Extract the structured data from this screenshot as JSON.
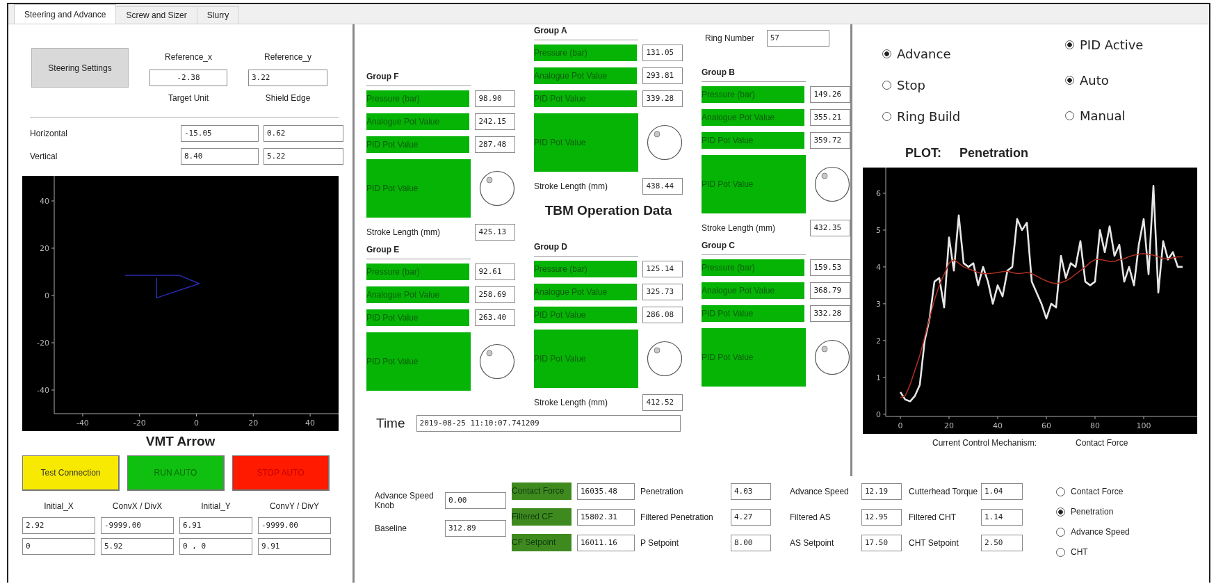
{
  "tabs": [
    {
      "label": "Steering and Advance",
      "selected": true
    },
    {
      "label": "Screw and Sizer",
      "selected": false
    },
    {
      "label": "Slurry",
      "selected": false
    }
  ],
  "steering": {
    "settings_button": "Steering Settings",
    "reference_x": {
      "label": "Reference_x",
      "value": "-2.38"
    },
    "reference_y": {
      "label": "Reference_y",
      "value": "3.22"
    },
    "captions": [
      "Target Unit",
      "Shield Edge"
    ],
    "offsets": [
      {
        "label": "Horizontal",
        "values": [
          "-15.05",
          "0.62"
        ]
      },
      {
        "label": "Vertical",
        "values": [
          "8.40",
          "5.22"
        ]
      }
    ]
  },
  "vmt_plot": {
    "title": "VMT Arrow",
    "chart_data": {
      "type": "line",
      "xlim": [
        -50,
        50
      ],
      "ylim": [
        -50,
        50
      ],
      "xticks": [
        -40,
        -20,
        0,
        20,
        40
      ],
      "yticks": [
        -40,
        -20,
        0,
        20,
        40
      ],
      "x": [
        -25,
        -6,
        1,
        -14,
        -14
      ],
      "series": [
        {
          "color": "#2a2ab0",
          "values": [
            8.5,
            8.5,
            5,
            -1,
            7.5
          ]
        }
      ]
    }
  },
  "action_buttons": [
    {
      "label": "Test Connection",
      "kind": "test"
    },
    {
      "label": "RUN AUTO",
      "kind": "run"
    },
    {
      "label": "STOP AUTO",
      "kind": "stop"
    }
  ],
  "calibration": {
    "columns": [
      "Initial_X",
      "ConvX / DivX",
      "Initial_Y",
      "ConvY / DivY"
    ],
    "rows": [
      [
        "2.92",
        "-9999.00",
        "6.91",
        "-9999.00"
      ],
      [
        "0",
        "5.92",
        "0 , 0",
        "9.91"
      ]
    ]
  },
  "operation": {
    "title": "TBM Operation Data",
    "ring_number": {
      "label": "Ring Number",
      "value": "57"
    },
    "columns": [
      {
        "groups": [
          {
            "name": "Group F",
            "readings": [
              {
                "label": "Pressure (bar)",
                "value": "98.90"
              },
              {
                "label": "Analogue Pot Value",
                "value": "242.15"
              },
              {
                "label": "PID Pot Value",
                "value": "287.48"
              }
            ],
            "pid_box": "PID Pot Value",
            "stroke": {
              "label": "Stroke Length (mm)",
              "value": "425.13"
            }
          },
          {
            "name": "Group E",
            "readings": [
              {
                "label": "Pressure (bar)",
                "value": "92.61"
              },
              {
                "label": "Analogue Pot Value",
                "value": "258.69"
              },
              {
                "label": "PID Pot Value",
                "value": "263.40"
              }
            ],
            "pid_box": "PID Pot Value"
          }
        ]
      },
      {
        "groups": [
          {
            "name": "Group A",
            "readings": [
              {
                "label": "Pressure (bar)",
                "value": "131.05"
              },
              {
                "label": "Analogue Pot Value",
                "value": "293.81"
              },
              {
                "label": "PID Pot Value",
                "value": "339.28"
              }
            ],
            "pid_box": "PID Pot Value",
            "stroke": {
              "label": "Stroke Length (mm)",
              "value": "438.44"
            }
          },
          {
            "name": "Group D",
            "readings": [
              {
                "label": "Pressure (bar)",
                "value": "125.14"
              },
              {
                "label": "Analogue Pot Value",
                "value": "325.73"
              },
              {
                "label": "PID Pot Value",
                "value": "286.08"
              }
            ],
            "pid_box": "PID Pot Value",
            "stroke": {
              "label": "Stroke Length (mm)",
              "value": "412.52"
            }
          }
        ]
      },
      {
        "groups": [
          {
            "name": "Group B",
            "readings": [
              {
                "label": "Pressure (bar)",
                "value": "149.26"
              },
              {
                "label": "Analogue Pot Value",
                "value": "355.21"
              },
              {
                "label": "PID Pot Value",
                "value": "359.72"
              }
            ],
            "pid_box": "PID Pot Value",
            "stroke": {
              "label": "Stroke Length (mm)",
              "value": "432.35"
            }
          },
          {
            "name": "Group C",
            "readings": [
              {
                "label": "Pressure (bar)",
                "value": "159.53"
              },
              {
                "label": "Analogue Pot Value",
                "value": "368.79"
              },
              {
                "label": "PID Pot Value",
                "value": "332.28"
              }
            ],
            "pid_box": "PID Pot Value"
          }
        ]
      }
    ],
    "time": {
      "label": "Time",
      "value": "2019-08-25 11:10:07.741209"
    }
  },
  "mode_radios": [
    {
      "label": "Advance",
      "selected": true
    },
    {
      "label": "Stop",
      "selected": false
    },
    {
      "label": "Ring Build",
      "selected": false
    }
  ],
  "pid_active": {
    "label": "PID Active",
    "selected": true
  },
  "control_radios": [
    {
      "label": "Auto",
      "selected": true
    },
    {
      "label": "Manual",
      "selected": false
    }
  ],
  "plot": {
    "label": "PLOT:",
    "variable": "Penetration",
    "chart_data": {
      "type": "line",
      "xlim": [
        -6,
        122
      ],
      "ylim": [
        -0.06,
        6.66
      ],
      "xticks": [
        0,
        20,
        40,
        60,
        80,
        100
      ],
      "yticks": [
        0,
        1,
        2,
        3,
        4,
        5,
        6
      ],
      "x": [
        0,
        2,
        4,
        6,
        8,
        10,
        12,
        14,
        16,
        18,
        20,
        22,
        24,
        26,
        28,
        30,
        32,
        34,
        36,
        38,
        40,
        42,
        44,
        46,
        48,
        50,
        52,
        54,
        56,
        58,
        60,
        62,
        64,
        66,
        68,
        70,
        72,
        74,
        76,
        78,
        80,
        82,
        84,
        86,
        88,
        90,
        92,
        94,
        96,
        98,
        100,
        102,
        104,
        106,
        108,
        110,
        112,
        114,
        116
      ],
      "series": [
        {
          "color": "#e6e6e6",
          "values": [
            0.6,
            0.4,
            0.35,
            0.5,
            0.8,
            2.0,
            2.6,
            3.6,
            3.7,
            2.9,
            4.8,
            3.9,
            5.4,
            4.1,
            4.0,
            4.1,
            3.5,
            4.0,
            3.6,
            3.0,
            3.5,
            3.2,
            3.9,
            4.0,
            5.3,
            5.0,
            5.2,
            3.6,
            3.3,
            3.0,
            2.6,
            3.0,
            2.9,
            4.3,
            3.7,
            4.1,
            4.0,
            4.7,
            3.6,
            3.5,
            3.6,
            5.0,
            4.4,
            5.1,
            4.3,
            4.6,
            3.6,
            4.0,
            3.5,
            4.6,
            5.3,
            3.8,
            6.2,
            3.3,
            4.7,
            4.2,
            4.4,
            4.0,
            4.0
          ]
        },
        {
          "color": "#b03020",
          "values": [
            0.45,
            0.5,
            0.8,
            1.2,
            1.6,
            2.1,
            2.6,
            3.1,
            3.5,
            3.8,
            4.1,
            4.2,
            4.1,
            4.0,
            3.95,
            3.9,
            3.85,
            3.82,
            3.82,
            3.83,
            3.85,
            3.87,
            3.88,
            3.85,
            3.82,
            3.83,
            3.85,
            3.82,
            3.75,
            3.68,
            3.62,
            3.57,
            3.55,
            3.57,
            3.62,
            3.7,
            3.8,
            3.9,
            4.0,
            4.12,
            4.2,
            4.2,
            4.18,
            4.15,
            4.15,
            4.2,
            4.22,
            4.28,
            4.32,
            4.35,
            4.36,
            4.34,
            4.32,
            4.28,
            4.22,
            4.22,
            4.25,
            4.27,
            4.27
          ]
        }
      ]
    },
    "caption": {
      "label": "Current Control Mechanism:",
      "value": "Contact Force"
    }
  },
  "bottom": {
    "knob": {
      "label": "Advance Speed Knob",
      "value": "0.00"
    },
    "baseline": {
      "label": "Baseline",
      "value": "312.89"
    },
    "metric_columns": [
      {
        "kind": "highlighted",
        "items": [
          {
            "label": "Contact Force",
            "value": "16035.48"
          },
          {
            "label": "Filtered CF",
            "value": "15802.31"
          },
          {
            "label": "CF Setpoint",
            "value": "16011.16"
          }
        ]
      },
      {
        "kind": "plain",
        "items": [
          {
            "label": "Penetration",
            "value": "4.03"
          },
          {
            "label": "Filtered Penetration",
            "value": "4.27"
          },
          {
            "label": "P Setpoint",
            "value": "8.00"
          }
        ]
      },
      {
        "kind": "plain",
        "items": [
          {
            "label": "Advance Speed",
            "value": "12.19"
          },
          {
            "label": "Filtered AS",
            "value": "12.95"
          },
          {
            "label": "AS Setpoint",
            "value": "17.50"
          }
        ]
      },
      {
        "kind": "plain",
        "items": [
          {
            "label": "Cutterhead Torque",
            "value": "1.04"
          },
          {
            "label": "Filtered CHT",
            "value": "1.14"
          },
          {
            "label": "CHT Setpoint",
            "value": "2.50"
          }
        ]
      }
    ],
    "plot_select": [
      {
        "label": "Contact Force",
        "selected": false
      },
      {
        "label": "Penetration",
        "selected": true
      },
      {
        "label": "Advance Speed",
        "selected": false
      },
      {
        "label": "CHT",
        "selected": false
      }
    ]
  }
}
